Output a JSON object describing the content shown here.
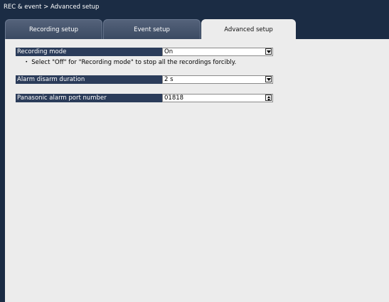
{
  "window": {
    "breadcrumb": "REC & event > Advanced setup"
  },
  "tabs": [
    {
      "label": "Recording setup",
      "active": false
    },
    {
      "label": "Event setup",
      "active": false
    },
    {
      "label": "Advanced setup",
      "active": true
    }
  ],
  "settings": {
    "recording_mode": {
      "label": "Recording mode",
      "value": "On",
      "control": "dropdown",
      "note": "・ Select \"Off\" for \"Recording mode\" to stop all the recordings forcibly."
    },
    "alarm_disarm_duration": {
      "label": "Alarm disarm duration",
      "value": "2 s",
      "control": "dropdown"
    },
    "panasonic_alarm_port_number": {
      "label": "Panasonic alarm port number",
      "value": "01818",
      "control": "spinner"
    }
  },
  "colors": {
    "frame": "#1b2c44",
    "label_bg": "#2b3c5a",
    "panel_bg": "#ececec",
    "inactive_tab": "#4a5870"
  },
  "icons": {
    "dropdown": "chevron-down-icon",
    "spinner": "spinner-arrows-icon"
  }
}
